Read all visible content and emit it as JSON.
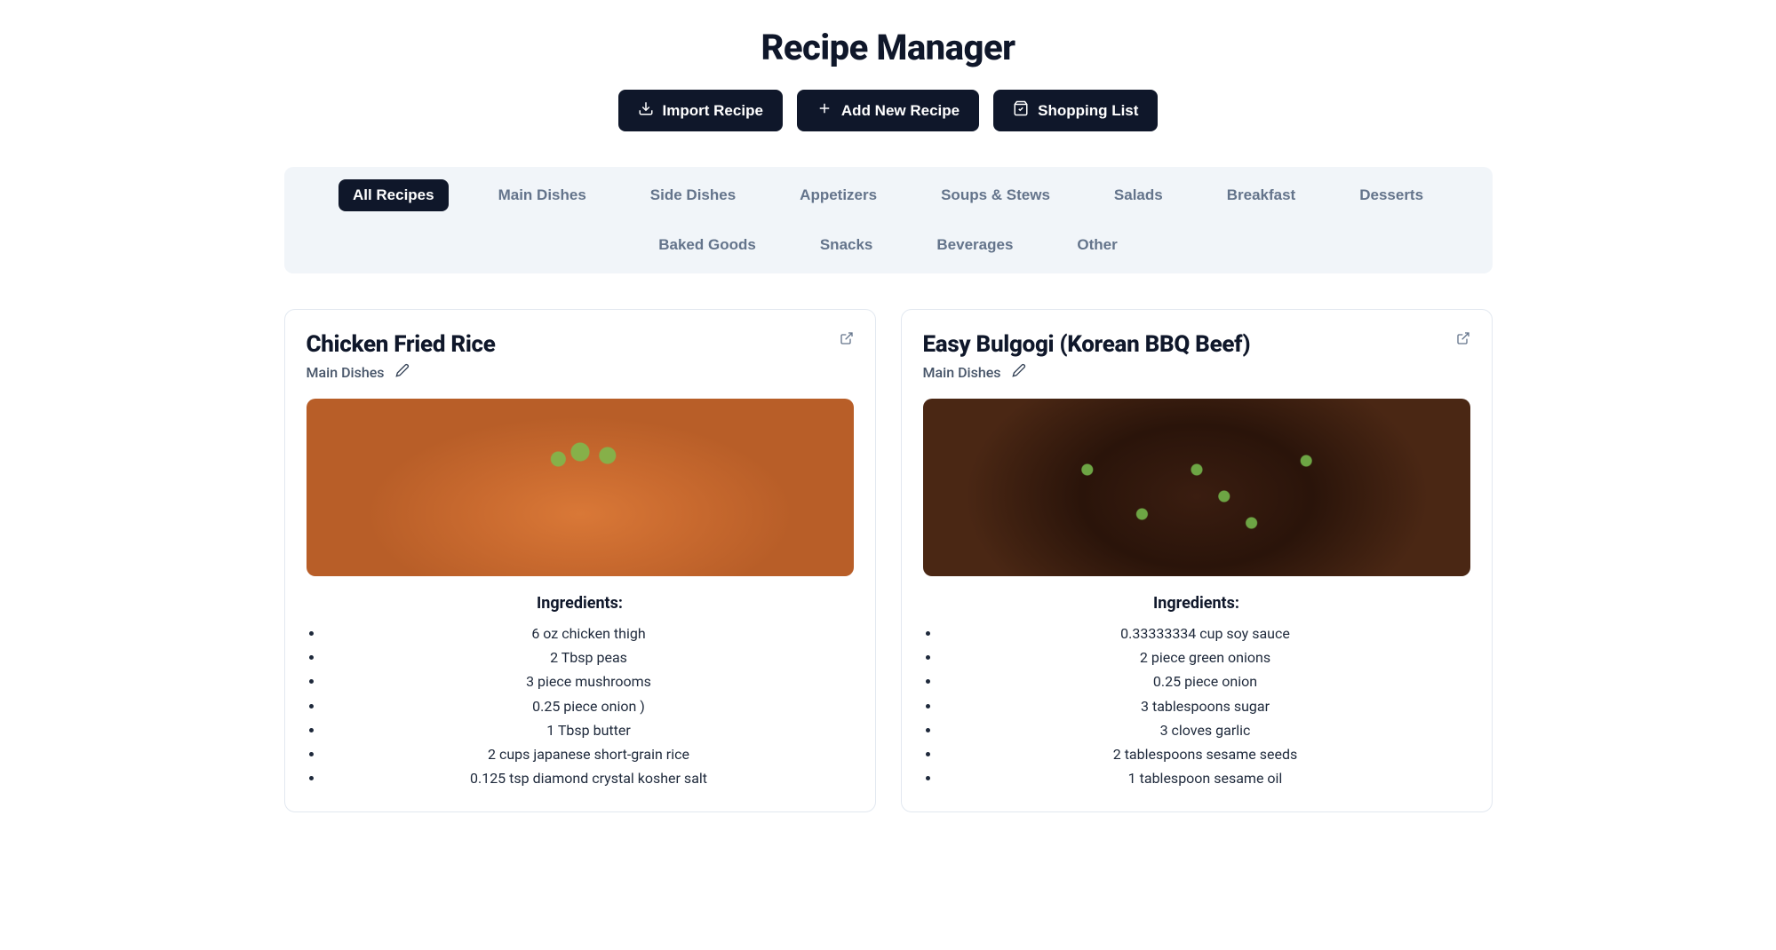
{
  "page_title": "Recipe Manager",
  "toolbar": {
    "import_label": "Import Recipe",
    "add_label": "Add New Recipe",
    "shopping_label": "Shopping List"
  },
  "tabs": [
    {
      "label": "All Recipes",
      "active": true
    },
    {
      "label": "Main Dishes",
      "active": false
    },
    {
      "label": "Side Dishes",
      "active": false
    },
    {
      "label": "Appetizers",
      "active": false
    },
    {
      "label": "Soups & Stews",
      "active": false
    },
    {
      "label": "Salads",
      "active": false
    },
    {
      "label": "Breakfast",
      "active": false
    },
    {
      "label": "Desserts",
      "active": false
    },
    {
      "label": "Baked Goods",
      "active": false
    },
    {
      "label": "Snacks",
      "active": false
    },
    {
      "label": "Beverages",
      "active": false
    },
    {
      "label": "Other",
      "active": false
    }
  ],
  "recipes": [
    {
      "title": "Chicken Fried Rice",
      "category": "Main Dishes",
      "image_class": "img-fried-rice",
      "ingredients_heading": "Ingredients:",
      "ingredients": [
        "6 oz chicken thigh",
        "2 Tbsp peas",
        "3 piece mushrooms",
        "0.25 piece onion )",
        "1 Tbsp butter",
        "2 cups japanese short-grain rice",
        "0.125 tsp diamond crystal kosher salt"
      ]
    },
    {
      "title": "Easy Bulgogi (Korean BBQ Beef)",
      "category": "Main Dishes",
      "image_class": "img-bulgogi",
      "ingredients_heading": "Ingredients:",
      "ingredients": [
        "0.33333334 cup soy sauce",
        "2 piece green onions",
        "0.25 piece onion",
        "3 tablespoons sugar",
        "3 cloves garlic",
        "2 tablespoons sesame seeds",
        "1 tablespoon sesame oil"
      ]
    }
  ]
}
